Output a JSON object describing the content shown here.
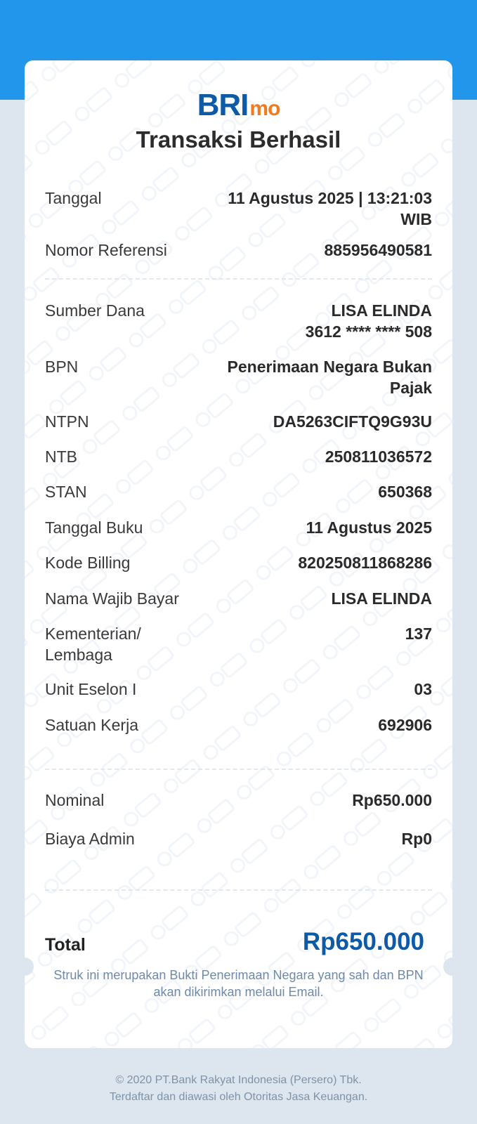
{
  "logo": {
    "bri": "BRI",
    "mo": "mo"
  },
  "title": "Transaksi Berhasil",
  "details": [
    {
      "label": "Tanggal",
      "value": "11 Agustus 2025 | 13:21:03 WIB"
    },
    {
      "label": "Nomor Referensi",
      "value": "885956490581"
    },
    {
      "label": "Sumber Dana",
      "value_line1": "LISA ELINDA",
      "value_line2": "3612 **** **** 508"
    },
    {
      "label": "BPN",
      "value": "Penerimaan Negara Bukan Pajak"
    },
    {
      "label": "NTPN",
      "value": "DA5263CIFTQ9G93U"
    },
    {
      "label": "NTB",
      "value": "250811036572"
    },
    {
      "label": "STAN",
      "value": "650368"
    },
    {
      "label": "Tanggal Buku",
      "value": "11 Agustus 2025"
    },
    {
      "label": "Kode Billing",
      "value": "820250811868286"
    },
    {
      "label": "Nama Wajib Bayar",
      "value": "LISA ELINDA"
    },
    {
      "label_line1": "Kementerian/",
      "label_line2": "Lembaga",
      "value": "137"
    },
    {
      "label": "Unit Eselon I",
      "value": "03"
    },
    {
      "label": "Satuan Kerja",
      "value": "692906"
    }
  ],
  "amounts": [
    {
      "label": "Nominal",
      "value": "Rp650.000"
    },
    {
      "label": "Biaya Admin",
      "value": "Rp0"
    }
  ],
  "total": {
    "label": "Total",
    "value": "Rp650.000"
  },
  "note": "Struk ini merupakan Bukti Penerimaan Negara yang sah dan BPN akan dikirimkan melalui Email.",
  "footer": {
    "line1": "© 2020 PT.Bank Rakyat Indonesia (Persero) Tbk.",
    "line2": "Terdaftar dan diawasi oleh Otoritas Jasa Keuangan."
  },
  "colors": {
    "header_blue": "#2196ea",
    "brand_blue": "#0d5aa7",
    "brand_orange": "#f27a1a",
    "background": "#dde6ef"
  }
}
